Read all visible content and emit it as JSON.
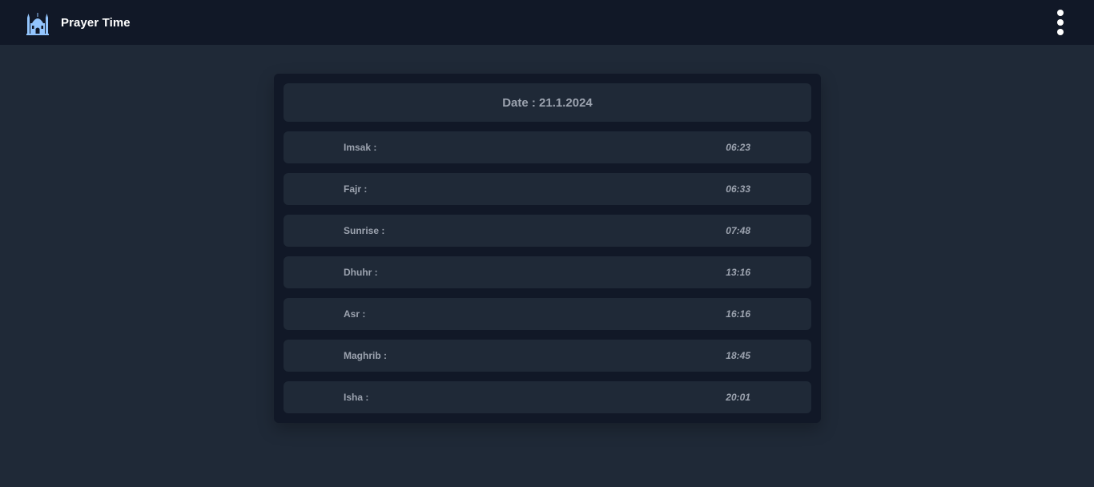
{
  "app": {
    "title": "Prayer Time",
    "icon": "mosque-icon",
    "menu_icon": "more-vertical-icon"
  },
  "colors": {
    "navbar_bg": "#111827",
    "page_bg": "#1f2937",
    "card_bg": "#111827",
    "row_bg": "#1f2937",
    "text_muted": "#9ca3af",
    "icon_accent": "#93c5fd"
  },
  "date": {
    "label": "Date : 21.1.2024"
  },
  "prayers": [
    {
      "name": "Imsak :",
      "time": "06:23"
    },
    {
      "name": "Fajr :",
      "time": "06:33"
    },
    {
      "name": "Sunrise :",
      "time": "07:48"
    },
    {
      "name": "Dhuhr :",
      "time": "13:16"
    },
    {
      "name": "Asr :",
      "time": "16:16"
    },
    {
      "name": "Maghrib :",
      "time": "18:45"
    },
    {
      "name": "Isha :",
      "time": "20:01"
    }
  ]
}
